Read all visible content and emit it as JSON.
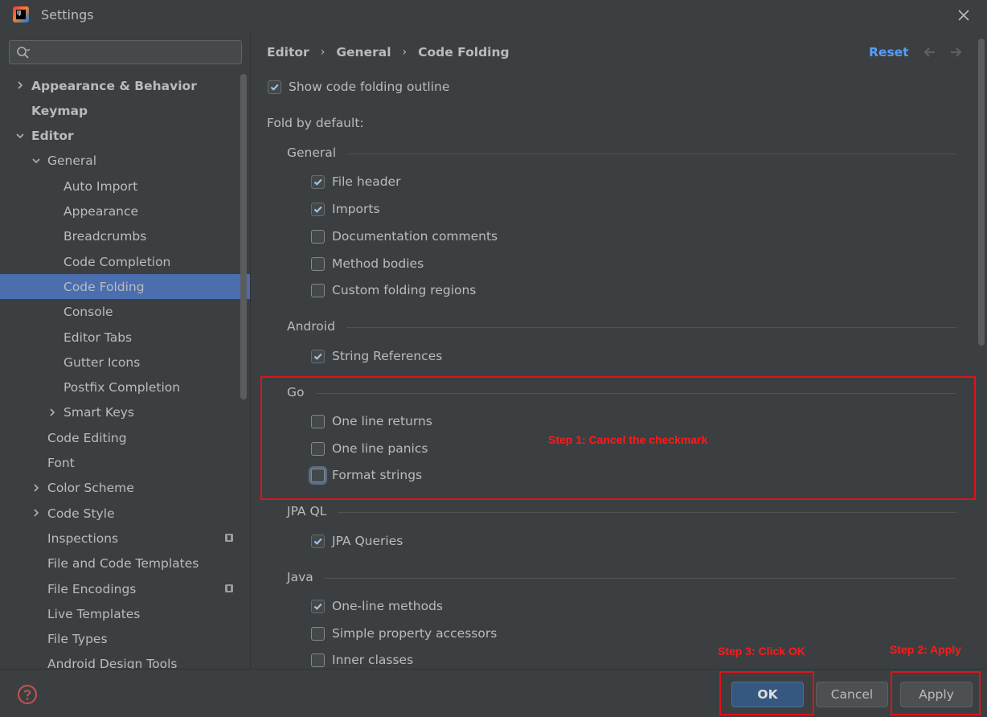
{
  "window": {
    "title": "Settings",
    "close_glyph": "✕"
  },
  "search": {
    "placeholder": "",
    "value": ""
  },
  "sidebar": {
    "items": [
      {
        "label": "Appearance & Behavior",
        "level": 0,
        "chevron": "right",
        "bold": true
      },
      {
        "label": "Keymap",
        "level": 0,
        "chevron": "none",
        "bold": true
      },
      {
        "label": "Editor",
        "level": 0,
        "chevron": "down",
        "bold": true
      },
      {
        "label": "General",
        "level": 1,
        "chevron": "down",
        "bold": false
      },
      {
        "label": "Auto Import",
        "level": 2,
        "chevron": "none",
        "bold": false
      },
      {
        "label": "Appearance",
        "level": 2,
        "chevron": "none",
        "bold": false
      },
      {
        "label": "Breadcrumbs",
        "level": 2,
        "chevron": "none",
        "bold": false
      },
      {
        "label": "Code Completion",
        "level": 2,
        "chevron": "none",
        "bold": false
      },
      {
        "label": "Code Folding",
        "level": 2,
        "chevron": "none",
        "bold": false,
        "selected": true
      },
      {
        "label": "Console",
        "level": 2,
        "chevron": "none",
        "bold": false
      },
      {
        "label": "Editor Tabs",
        "level": 2,
        "chevron": "none",
        "bold": false
      },
      {
        "label": "Gutter Icons",
        "level": 2,
        "chevron": "none",
        "bold": false
      },
      {
        "label": "Postfix Completion",
        "level": 2,
        "chevron": "none",
        "bold": false
      },
      {
        "label": "Smart Keys",
        "level": 2,
        "chevron": "right",
        "bold": false
      },
      {
        "label": "Code Editing",
        "level": 1,
        "chevron": "none",
        "bold": false
      },
      {
        "label": "Font",
        "level": 1,
        "chevron": "none",
        "bold": false
      },
      {
        "label": "Color Scheme",
        "level": 1,
        "chevron": "right",
        "bold": false
      },
      {
        "label": "Code Style",
        "level": 1,
        "chevron": "right",
        "bold": false
      },
      {
        "label": "Inspections",
        "level": 1,
        "chevron": "none",
        "bold": false,
        "badge": "project-icon"
      },
      {
        "label": "File and Code Templates",
        "level": 1,
        "chevron": "none",
        "bold": false
      },
      {
        "label": "File Encodings",
        "level": 1,
        "chevron": "none",
        "bold": false,
        "badge": "project-icon"
      },
      {
        "label": "Live Templates",
        "level": 1,
        "chevron": "none",
        "bold": false
      },
      {
        "label": "File Types",
        "level": 1,
        "chevron": "none",
        "bold": false
      },
      {
        "label": "Android Design Tools",
        "level": 1,
        "chevron": "none",
        "bold": false
      }
    ]
  },
  "breadcrumb": {
    "parts": [
      "Editor",
      "General",
      "Code Folding"
    ],
    "separator": "›"
  },
  "header": {
    "reset_label": "Reset"
  },
  "content": {
    "show_outline": {
      "label": "Show code folding outline",
      "checked": true
    },
    "fold_by_default_label": "Fold by default:",
    "groups": [
      {
        "title": "General",
        "items": [
          {
            "label": "File header",
            "checked": true
          },
          {
            "label": "Imports",
            "checked": true
          },
          {
            "label": "Documentation comments",
            "checked": false
          },
          {
            "label": "Method bodies",
            "checked": false
          },
          {
            "label": "Custom folding regions",
            "checked": false
          }
        ]
      },
      {
        "title": "Android",
        "items": [
          {
            "label": "String References",
            "checked": true
          }
        ]
      },
      {
        "title": "Go",
        "items": [
          {
            "label": "One line returns",
            "checked": false
          },
          {
            "label": "One line panics",
            "checked": false
          },
          {
            "label": "Format strings",
            "checked": false,
            "focused": true
          }
        ]
      },
      {
        "title": "JPA QL",
        "items": [
          {
            "label": "JPA Queries",
            "checked": true
          }
        ]
      },
      {
        "title": "Java",
        "items": [
          {
            "label": "One-line methods",
            "checked": true
          },
          {
            "label": "Simple property accessors",
            "checked": false
          },
          {
            "label": "Inner classes",
            "checked": false
          }
        ]
      }
    ]
  },
  "annotations": {
    "step1": "Step 1: Cancel the  checkmark",
    "step2": "Step 2:  Apply",
    "step3": "Step 3: Click OK",
    "color": "#e0121a"
  },
  "footer": {
    "ok_label": "OK",
    "cancel_label": "Cancel",
    "apply_label": "Apply"
  },
  "colors": {
    "background": "#3c3f41",
    "selection": "#4b6eaf",
    "link": "#589df6",
    "primary_button": "#365880"
  }
}
